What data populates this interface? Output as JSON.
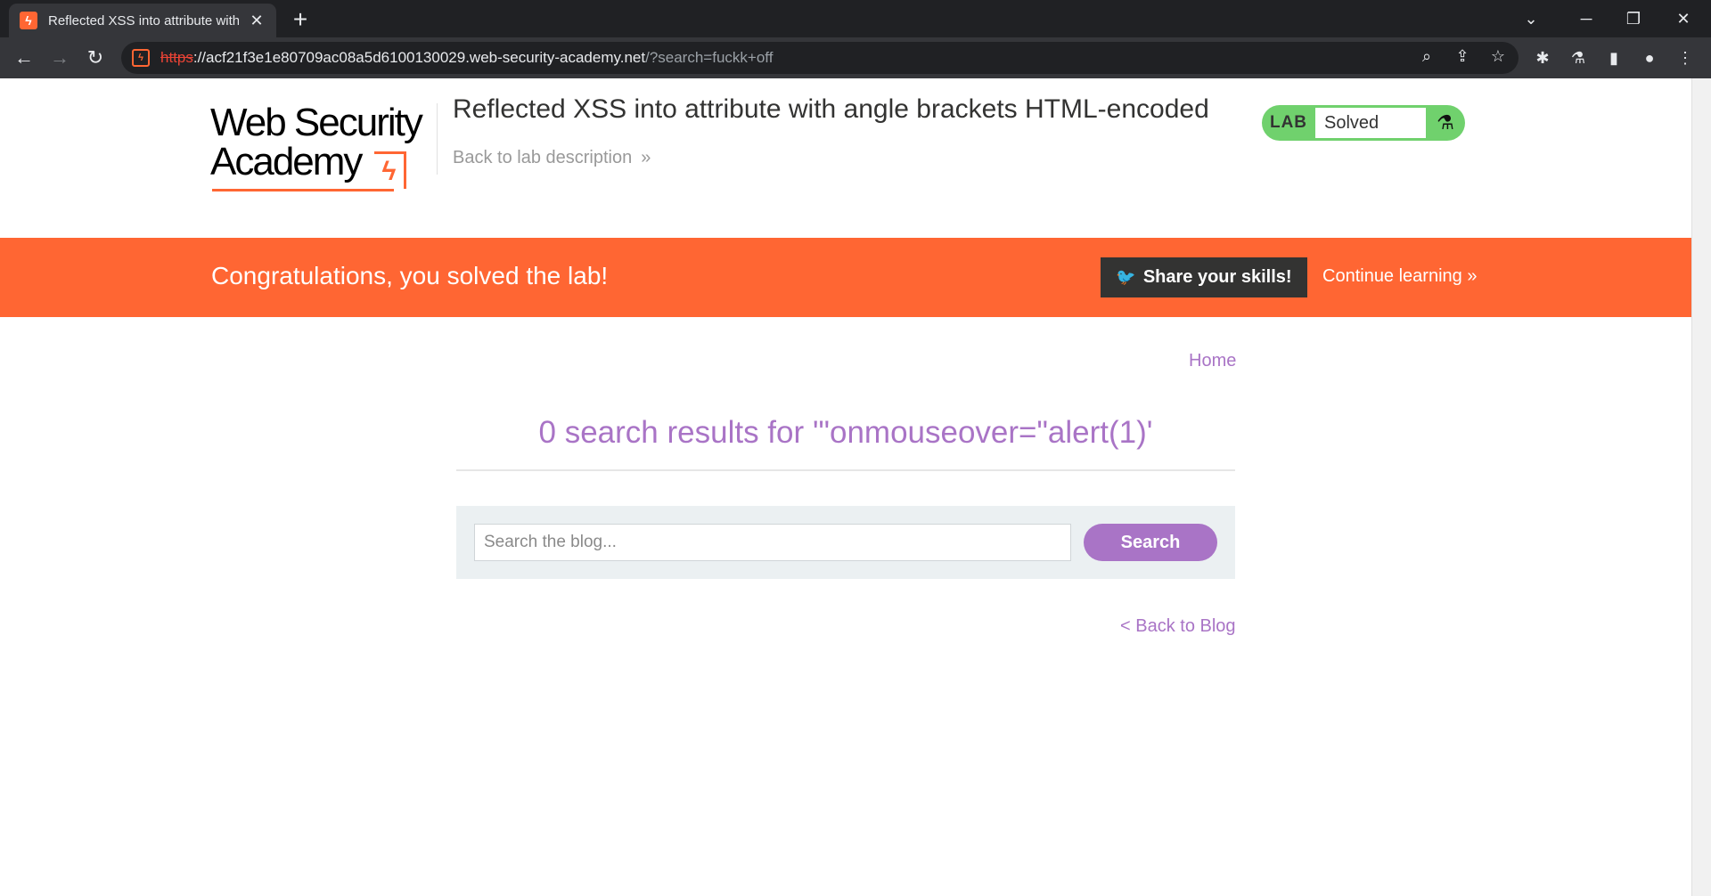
{
  "browser": {
    "tab_title": "Reflected XSS into attribute with",
    "url_scheme": "https",
    "url_host": "://acf21f3e1e80709ac08a5d6100130029.web-security-academy.net",
    "url_path": "/?search=fuckk+off",
    "new_tab_icon": "plus-icon",
    "colors": {
      "tabstrip": "#202124",
      "toolbar": "#35363a"
    }
  },
  "header": {
    "logo_line1": "Web Security",
    "logo_line2": "Academy",
    "lab_title": "Reflected XSS into attribute with angle brackets HTML-encoded",
    "back_link": "Back to lab description",
    "status_tag": "LAB",
    "status_value": "Solved"
  },
  "banner": {
    "message": "Congratulations, you solved the lab!",
    "share_label": "Share your skills!",
    "continue_label": "Continue learning",
    "color": "#ff6633"
  },
  "main": {
    "home_link": "Home",
    "results_heading": "0 search results for '\"onmouseover=\"alert(1)'",
    "search_placeholder": "Search the blog...",
    "search_button": "Search",
    "back_to_blog": "< Back to Blog",
    "accent_color": "#a974c6"
  }
}
